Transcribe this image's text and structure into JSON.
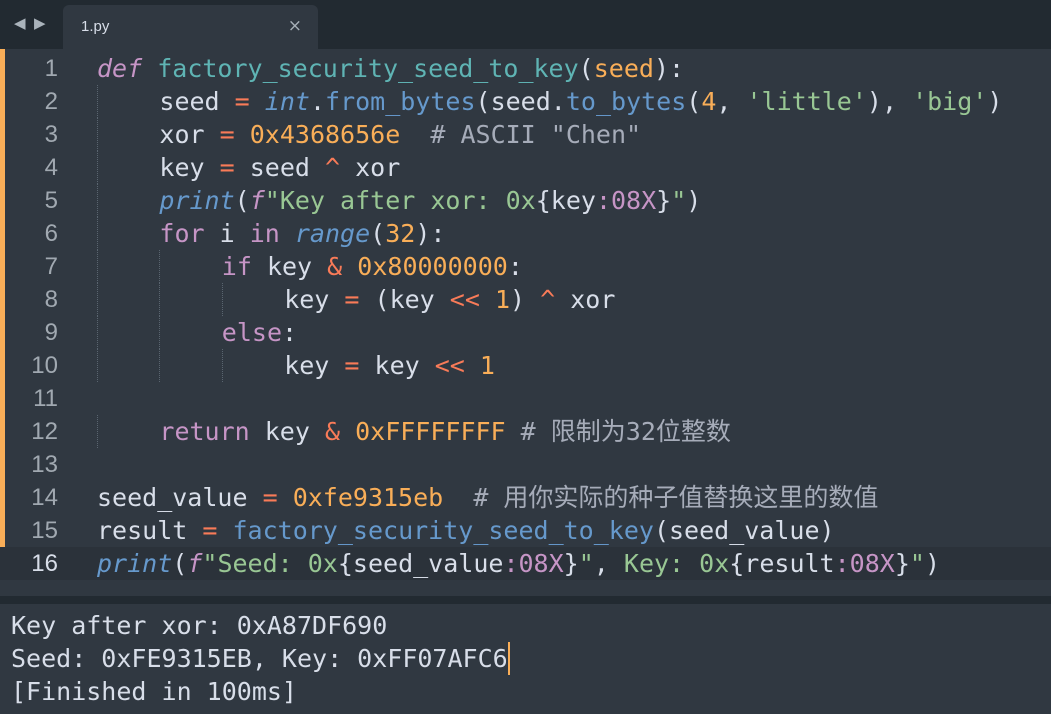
{
  "tabbar": {
    "back_arrow": "◀",
    "forward_arrow": "▶",
    "tab_label": "1.py",
    "close_glyph": "×"
  },
  "editor": {
    "active_line": 16,
    "lines": [
      {
        "n": "1",
        "indent": 0,
        "tokens": [
          [
            "def",
            "k-def"
          ],
          [
            " ",
            ""
          ],
          [
            "factory_security_seed_to_key",
            "k-fn"
          ],
          [
            "(",
            ""
          ],
          [
            "seed",
            "k-param"
          ],
          [
            "):",
            ""
          ]
        ]
      },
      {
        "n": "2",
        "indent": 1,
        "tokens": [
          [
            "seed",
            ""
          ],
          [
            " ",
            ""
          ],
          [
            "=",
            "k-op"
          ],
          [
            " ",
            ""
          ],
          [
            "int",
            "k-builtin"
          ],
          [
            ".",
            ""
          ],
          [
            "from_bytes",
            "k-attr"
          ],
          [
            "(seed.",
            ""
          ],
          [
            "to_bytes",
            "k-attr"
          ],
          [
            "(",
            ""
          ],
          [
            "4",
            "k-num"
          ],
          [
            ", ",
            ""
          ],
          [
            "'little'",
            "k-str"
          ],
          [
            "), ",
            ""
          ],
          [
            "'big'",
            "k-str"
          ],
          [
            ")",
            ""
          ]
        ]
      },
      {
        "n": "3",
        "indent": 1,
        "tokens": [
          [
            "xor",
            ""
          ],
          [
            " ",
            ""
          ],
          [
            "=",
            "k-op"
          ],
          [
            " ",
            ""
          ],
          [
            "0x4368656e",
            "k-num"
          ],
          [
            "  ",
            ""
          ],
          [
            "# ASCII \"Chen\"",
            "k-cmt"
          ]
        ]
      },
      {
        "n": "4",
        "indent": 1,
        "tokens": [
          [
            "key",
            ""
          ],
          [
            " ",
            ""
          ],
          [
            "=",
            "k-op"
          ],
          [
            " seed ",
            ""
          ],
          [
            "^",
            "k-op"
          ],
          [
            " xor",
            ""
          ]
        ]
      },
      {
        "n": "5",
        "indent": 1,
        "tokens": [
          [
            "print",
            "k-builtin"
          ],
          [
            "(",
            ""
          ],
          [
            "f",
            "k-def"
          ],
          [
            "\"Key after xor: 0x",
            "k-str"
          ],
          [
            "{key",
            "k-brace"
          ],
          [
            ":08X",
            "k-fmt"
          ],
          [
            "}",
            "k-brace"
          ],
          [
            "\"",
            "k-str"
          ],
          [
            ")",
            ""
          ]
        ]
      },
      {
        "n": "6",
        "indent": 1,
        "tokens": [
          [
            "for",
            "k-kw"
          ],
          [
            " i ",
            ""
          ],
          [
            "in",
            "k-kw"
          ],
          [
            " ",
            ""
          ],
          [
            "range",
            "k-builtin"
          ],
          [
            "(",
            ""
          ],
          [
            "32",
            "k-num"
          ],
          [
            "):",
            ""
          ]
        ]
      },
      {
        "n": "7",
        "indent": 2,
        "tokens": [
          [
            "if",
            "k-kw"
          ],
          [
            " key ",
            ""
          ],
          [
            "&",
            "k-op"
          ],
          [
            " ",
            ""
          ],
          [
            "0x80000000",
            "k-num"
          ],
          [
            ":",
            ""
          ]
        ]
      },
      {
        "n": "8",
        "indent": 3,
        "tokens": [
          [
            "key",
            ""
          ],
          [
            " ",
            ""
          ],
          [
            "=",
            "k-op"
          ],
          [
            " (key ",
            ""
          ],
          [
            "<<",
            "k-op"
          ],
          [
            " ",
            ""
          ],
          [
            "1",
            "k-num"
          ],
          [
            ") ",
            ""
          ],
          [
            "^",
            "k-op"
          ],
          [
            " xor",
            ""
          ]
        ]
      },
      {
        "n": "9",
        "indent": 2,
        "tokens": [
          [
            "else",
            "k-kw"
          ],
          [
            ":",
            ""
          ]
        ]
      },
      {
        "n": "10",
        "indent": 3,
        "tokens": [
          [
            "key",
            ""
          ],
          [
            " ",
            ""
          ],
          [
            "=",
            "k-op"
          ],
          [
            " key ",
            ""
          ],
          [
            "<<",
            "k-op"
          ],
          [
            " ",
            ""
          ],
          [
            "1",
            "k-num"
          ]
        ]
      },
      {
        "n": "11",
        "indent": 0,
        "tokens": []
      },
      {
        "n": "12",
        "indent": 1,
        "tokens": [
          [
            "return",
            "k-kw"
          ],
          [
            " key ",
            ""
          ],
          [
            "&",
            "k-op"
          ],
          [
            " ",
            ""
          ],
          [
            "0xFFFFFFFF",
            "k-num"
          ],
          [
            " ",
            ""
          ],
          [
            "# 限制为32位整数",
            "k-cmt"
          ]
        ]
      },
      {
        "n": "13",
        "indent": 0,
        "tokens": []
      },
      {
        "n": "14",
        "indent": 0,
        "tokens": [
          [
            "seed_value",
            ""
          ],
          [
            " ",
            ""
          ],
          [
            "=",
            "k-op"
          ],
          [
            " ",
            ""
          ],
          [
            "0xfe9315eb",
            "k-num"
          ],
          [
            "  ",
            ""
          ],
          [
            "# 用你实际的种子值替换这里的数值",
            "k-cmt"
          ]
        ]
      },
      {
        "n": "15",
        "indent": 0,
        "tokens": [
          [
            "result",
            ""
          ],
          [
            " ",
            ""
          ],
          [
            "=",
            "k-op"
          ],
          [
            " ",
            ""
          ],
          [
            "factory_security_seed_to_key",
            "k-attr"
          ],
          [
            "(seed_value)",
            ""
          ]
        ]
      },
      {
        "n": "16",
        "indent": 0,
        "tokens": [
          [
            "print",
            "k-builtin"
          ],
          [
            "(",
            ""
          ],
          [
            "f",
            "k-def"
          ],
          [
            "\"Seed: 0x",
            "k-str"
          ],
          [
            "{seed_value",
            "k-brace"
          ],
          [
            ":08X",
            "k-fmt"
          ],
          [
            "}",
            "k-brace"
          ],
          [
            "\"",
            "k-str"
          ],
          [
            ", ",
            ""
          ],
          [
            "Key: 0x",
            "k-str"
          ],
          [
            "{result",
            "k-brace"
          ],
          [
            ":08X",
            "k-fmt"
          ],
          [
            "}",
            "k-brace"
          ],
          [
            "\"",
            "k-str"
          ],
          [
            ")",
            ""
          ]
        ]
      }
    ]
  },
  "output": {
    "lines": [
      "Key after xor: 0xA87DF690",
      "Seed: 0xFE9315EB, Key: 0xFF07AFC6",
      "[Finished in 100ms]"
    ]
  },
  "colors": {
    "background": "#303841",
    "tabbar": "#222a31",
    "gutter_marker": "#f9ae58"
  }
}
